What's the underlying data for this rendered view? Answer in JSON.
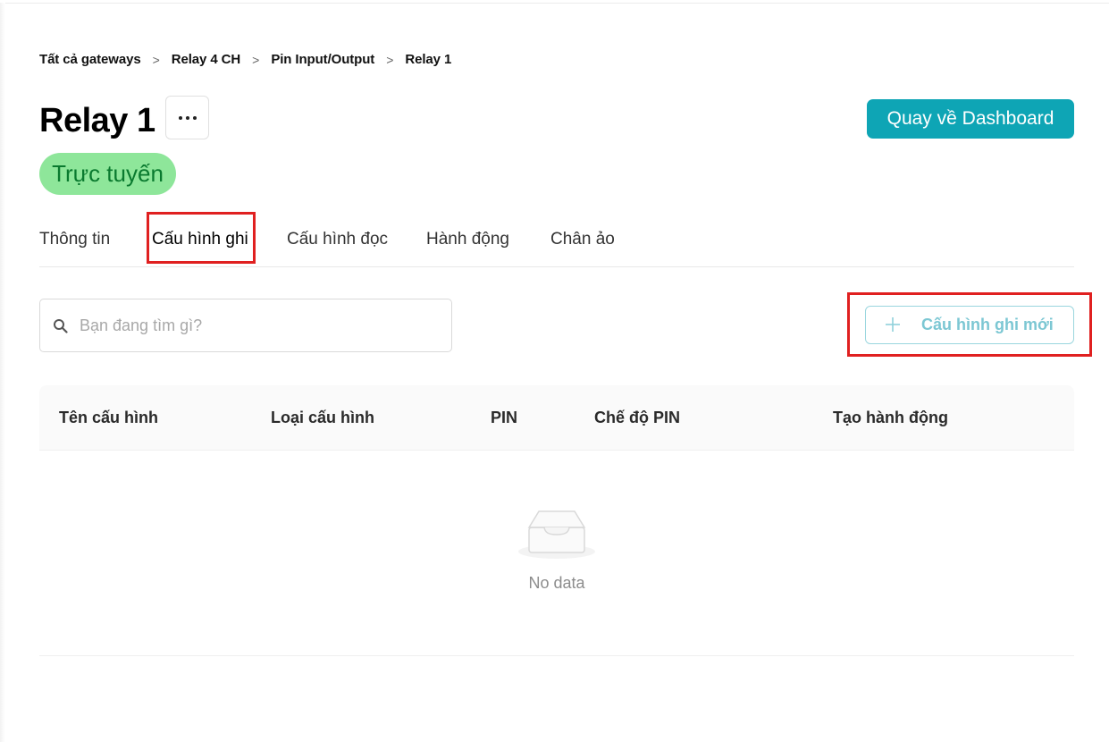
{
  "breadcrumb": {
    "items": [
      "Tất cả gateways",
      "Relay 4 CH",
      "Pin Input/Output",
      "Relay 1"
    ],
    "separator": ">"
  },
  "header": {
    "title": "Relay 1",
    "more_icon": "ellipsis-icon",
    "dashboard_button": "Quay về Dashboard",
    "status": "Trực tuyến"
  },
  "tabs": [
    {
      "label": "Thông tin",
      "active": false
    },
    {
      "label": "Cấu hình ghi",
      "active": true
    },
    {
      "label": "Cấu hình đọc",
      "active": false
    },
    {
      "label": "Hành động",
      "active": false
    },
    {
      "label": "Chân ảo",
      "active": false
    }
  ],
  "search": {
    "placeholder": "Bạn đang tìm gì?",
    "value": "",
    "icon": "search-icon"
  },
  "new_button": {
    "label": "Cấu hình ghi mới",
    "icon": "plus-icon"
  },
  "table": {
    "columns": [
      "Tên cấu hình",
      "Loại cấu hình",
      "PIN",
      "Chế độ PIN",
      "Tạo hành động"
    ],
    "rows": [],
    "empty_text": "No data",
    "empty_icon": "empty-inbox-icon"
  },
  "colors": {
    "accent": "#0ea5b5",
    "status_bg": "#8ee69a",
    "status_text": "#0a7a2f",
    "highlight": "#e02020"
  }
}
